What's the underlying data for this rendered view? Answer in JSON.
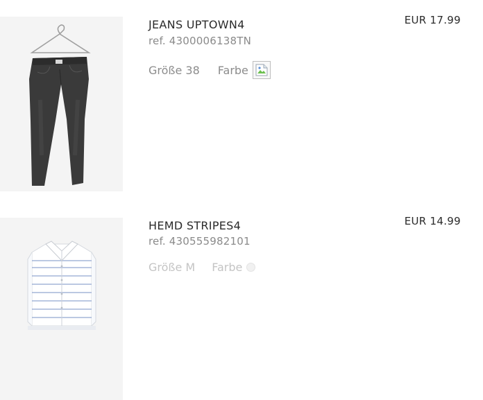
{
  "products": [
    {
      "name": "JEANS UPTOWN4",
      "ref": "ref. 4300006138TN",
      "size_label": "Größe 38",
      "color_label": "Farbe",
      "price": "EUR 17.99",
      "image": "jeans-image"
    },
    {
      "name": "HEMD STRIPES4",
      "ref": "ref. 430555982101",
      "size_label": "Größe M",
      "color_label": "Farbe",
      "price": "EUR 14.99",
      "image": "shirt-image"
    }
  ],
  "colors": {
    "text_dark": "#2a2a2a",
    "text_muted": "#8c8c8c",
    "text_disabled": "#c4c4c4",
    "thumb_bg": "#f4f4f4"
  }
}
